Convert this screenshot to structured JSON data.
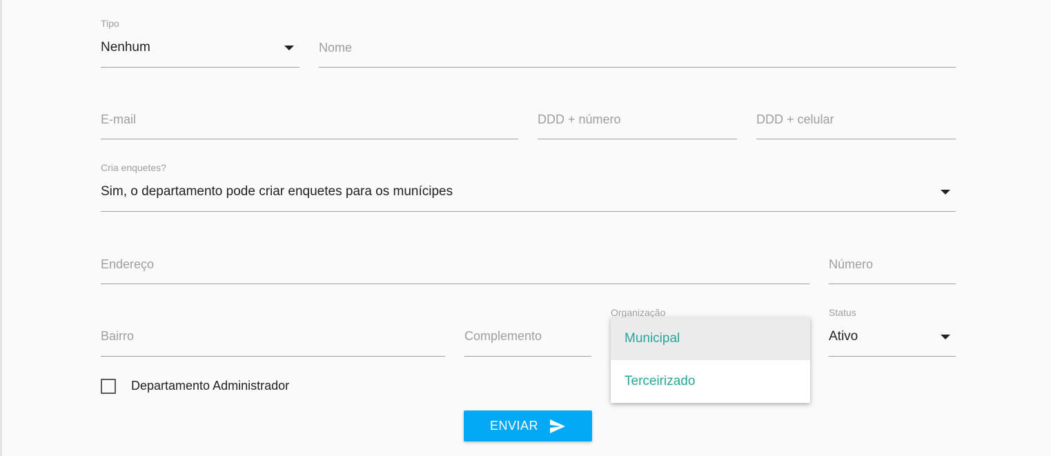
{
  "form": {
    "tipo": {
      "label": "Tipo",
      "value": "Nenhum"
    },
    "nome": {
      "placeholder": "Nome"
    },
    "email": {
      "placeholder": "E-mail"
    },
    "telefone": {
      "placeholder": "DDD + número"
    },
    "celular": {
      "placeholder": "DDD + celular"
    },
    "cria_enquetes": {
      "label": "Cria enquetes?",
      "value": "Sim, o departamento pode criar enquetes para os munícipes"
    },
    "endereco": {
      "placeholder": "Endereço"
    },
    "numero": {
      "placeholder": "Número"
    },
    "bairro": {
      "placeholder": "Bairro"
    },
    "complemento": {
      "placeholder": "Complemento"
    },
    "organizacao": {
      "label": "Organização",
      "options": [
        "Municipal",
        "Terceirizado"
      ],
      "highlighted": "Municipal"
    },
    "status": {
      "label": "Status",
      "value": "Ativo"
    },
    "admin_checkbox": {
      "label": "Departamento Administrador",
      "checked": false
    },
    "submit": {
      "label": "ENVIAR",
      "icon": "send-icon"
    }
  },
  "colors": {
    "accent_teal": "#26a69a",
    "button_blue": "#03a9f4",
    "underline": "#9e9e9e"
  }
}
